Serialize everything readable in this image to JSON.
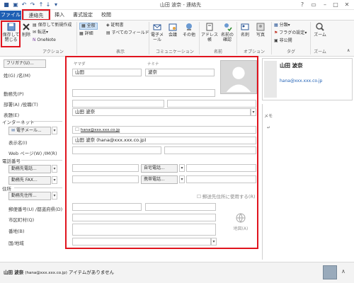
{
  "window": {
    "title": "山田 波奈 - 連絡先"
  },
  "tabs": [
    {
      "label": "ファイル"
    },
    {
      "label": "連絡先"
    },
    {
      "label": "挿入"
    },
    {
      "label": "書式設定"
    },
    {
      "label": "校閲"
    }
  ],
  "ribbon": {
    "save_close": "保存して閉じる",
    "delete": "削除",
    "save_new": "保存して新規作成",
    "forward": "転送",
    "onenote": "OneNote",
    "group_action": "アクション",
    "general": "全般",
    "detail": "詳細",
    "certificate": "証明書",
    "all_fields": "すべてのフィールド",
    "group_display": "表示",
    "email": "電子メール",
    "meeting": "会議",
    "other": "その他",
    "group_comm": "コミュニケーション",
    "address_book": "アドレス帳",
    "check_names": "名前の確認",
    "group_names": "名前",
    "business_card": "名刺",
    "picture": "写真",
    "group_options": "オプション",
    "categorize": "分類",
    "followup": "フラグの設定",
    "private": "非公開",
    "group_tags": "タグ",
    "zoom": "ズーム",
    "group_zoom": "ズーム"
  },
  "form": {
    "furigana_button": "フリガナ(U)...",
    "yomi_last": "ヤマダ",
    "yomi_first": "ナミナ",
    "name_label": "姓(G) /名(M)",
    "last_name": "山田",
    "first_name": "波奈",
    "company_label": "勤務先(P)",
    "dept_label": "部署(A) /役職(T)",
    "display_label": "表題(E)",
    "display_value": "山田 波奈",
    "internet_section": "インターネット",
    "email_button": "電子メール...",
    "email_value": "hana@xxx.xxx.co.jp",
    "display_name_label": "表示名(I)",
    "display_name_value": "山田 波奈 (hana@xxx.xxx.co.jp)",
    "webpage_label": "Web ページ(W) /IM(R)",
    "phone_section": "電話番号",
    "work_phone_button": "勤務先電話...",
    "home_phone_button": "自宅電話...",
    "work_fax_button": "勤務先 FAX...",
    "mobile_button": "携帯電話...",
    "address_section": "住所",
    "work_address_button": "勤務先住所...",
    "mail_address_checkbox": "郵送先住所に使用する(R)",
    "postal_label": "郵便番号(U) /都道府県(D)",
    "city_label": "市区町村(Q)",
    "street_label": "番地(B)",
    "country_label": "国/地域",
    "map_button": "地図(A)"
  },
  "card": {
    "name": "山田 波奈",
    "email": "hana@xxx.xxx.co.jp"
  },
  "notes": {
    "label": "メモ"
  },
  "status": {
    "name": "山田 波奈",
    "email": "(hana@xxx.xxx.co.jp)",
    "message": "アイテムがありません"
  }
}
